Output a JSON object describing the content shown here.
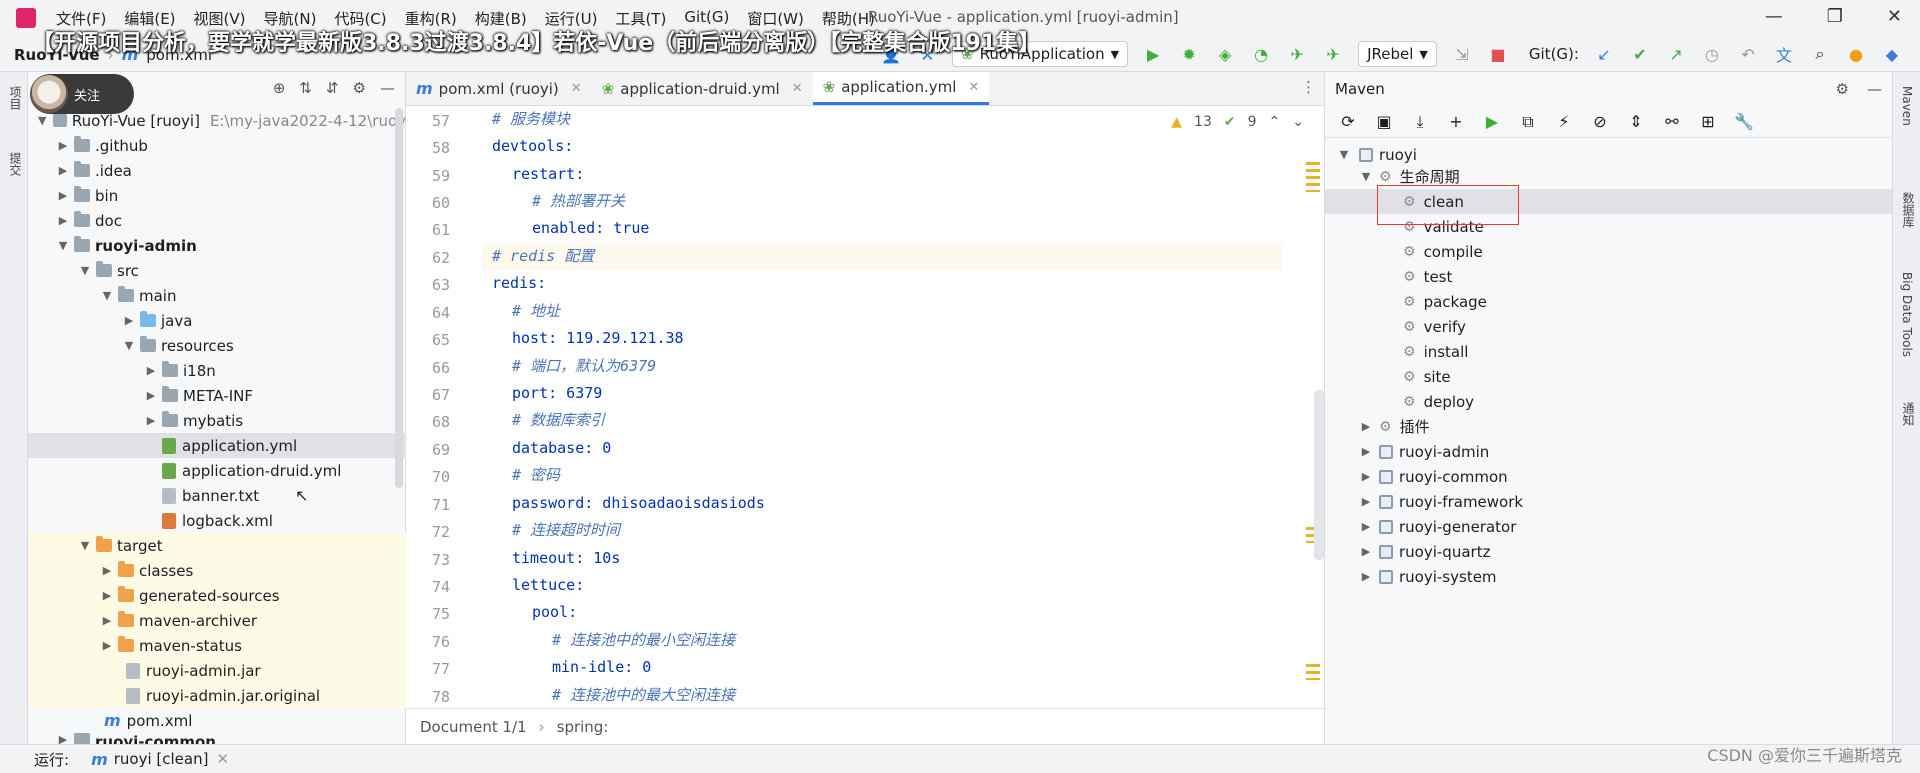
{
  "titlebar": {
    "menu": [
      "文件(F)",
      "编辑(E)",
      "视图(V)",
      "导航(N)",
      "代码(C)",
      "重构(R)",
      "构建(B)",
      "运行(U)",
      "工具(T)",
      "Git(G)",
      "窗口(W)",
      "帮助(H)"
    ],
    "window_title": "RuoYi-Vue - application.yml [ruoyi-admin]",
    "banner": "【开源项目分析，要学就学最新版3.8.3过渡3.8.4】若依-Vue（前后端分离版）【完整集合版191集】"
  },
  "navbar": {
    "crumb_project": "RuoYi-Vue",
    "crumb_file": "pom.xml",
    "run_config": "RuoYiApplication",
    "jrebel": "JRebel",
    "git_label": "Git(G):"
  },
  "left_stripe": {
    "project": "项目",
    "commit": "提交"
  },
  "right_stripe": {
    "maven": "Maven",
    "database": "数据库",
    "bigdata": "Big Data Tools",
    "notify": "通知"
  },
  "project": {
    "follow": "关注",
    "root_name": "RuoYi-Vue [ruoyi]",
    "root_path": "E:\\my-java2022-4-12\\ruoy",
    "items": [
      {
        "label": ".github",
        "kind": "folder"
      },
      {
        "label": ".idea",
        "kind": "folder"
      },
      {
        "label": "bin",
        "kind": "folder"
      },
      {
        "label": "doc",
        "kind": "folder"
      },
      {
        "label": "ruoyi-admin",
        "kind": "module"
      },
      {
        "label": "src",
        "kind": "folder"
      },
      {
        "label": "main",
        "kind": "folder"
      },
      {
        "label": "java",
        "kind": "folder"
      },
      {
        "label": "resources",
        "kind": "folder"
      },
      {
        "label": "i18n",
        "kind": "folder"
      },
      {
        "label": "META-INF",
        "kind": "folder"
      },
      {
        "label": "mybatis",
        "kind": "folder"
      },
      {
        "label": "application.yml",
        "kind": "file"
      },
      {
        "label": "application-druid.yml",
        "kind": "file"
      },
      {
        "label": "banner.txt",
        "kind": "file"
      },
      {
        "label": "logback.xml",
        "kind": "file"
      },
      {
        "label": "target",
        "kind": "folder"
      },
      {
        "label": "classes",
        "kind": "folder"
      },
      {
        "label": "generated-sources",
        "kind": "folder"
      },
      {
        "label": "maven-archiver",
        "kind": "folder"
      },
      {
        "label": "maven-status",
        "kind": "folder"
      },
      {
        "label": "ruoyi-admin.jar",
        "kind": "file"
      },
      {
        "label": "ruoyi-admin.jar.original",
        "kind": "file"
      },
      {
        "label": "pom.xml",
        "kind": "file"
      },
      {
        "label": "ruoyi-common",
        "kind": "module"
      }
    ]
  },
  "editor": {
    "tabs": [
      "pom.xml (ruoyi)",
      "application-druid.yml",
      "application.yml"
    ],
    "warnings": "13",
    "weak_warnings": "9",
    "lines": [
      {
        "no": "57",
        "text": "# 服务模块"
      },
      {
        "no": "58",
        "text": "devtools:"
      },
      {
        "no": "59",
        "text": "restart:"
      },
      {
        "no": "60",
        "text": "# 热部署开关"
      },
      {
        "no": "61",
        "text": "enabled: true"
      },
      {
        "no": "62",
        "text": "# redis 配置"
      },
      {
        "no": "63",
        "text": "redis:"
      },
      {
        "no": "64",
        "text": "# 地址"
      },
      {
        "no": "65",
        "text": "host: 119.29.121.38"
      },
      {
        "no": "66",
        "text": "# 端口，默认为6379"
      },
      {
        "no": "67",
        "text": "port: 6379"
      },
      {
        "no": "68",
        "text": "# 数据库索引"
      },
      {
        "no": "69",
        "text": "database: 0"
      },
      {
        "no": "70",
        "text": "# 密码"
      },
      {
        "no": "71",
        "text": "password: dhisoadaoisdasiods"
      },
      {
        "no": "72",
        "text": "# 连接超时时间"
      },
      {
        "no": "73",
        "text": "timeout: 10s"
      },
      {
        "no": "74",
        "text": "lettuce:"
      },
      {
        "no": "75",
        "text": "pool:"
      },
      {
        "no": "76",
        "text": "# 连接池中的最小空闲连接"
      },
      {
        "no": "77",
        "text": "min-idle: 0"
      },
      {
        "no": "78",
        "text": "# 连接池中的最大空闲连接"
      }
    ],
    "footer_doc": "Document 1/1",
    "footer_path": "spring:"
  },
  "maven": {
    "title": "Maven",
    "root": "ruoyi",
    "lifecycle": "生命周期",
    "phases": [
      "clean",
      "validate",
      "compile",
      "test",
      "package",
      "verify",
      "install",
      "site",
      "deploy"
    ],
    "plugins": "插件",
    "modules": [
      "ruoyi-admin",
      "ruoyi-common",
      "ruoyi-framework",
      "ruoyi-generator",
      "ruoyi-quartz",
      "ruoyi-system"
    ]
  },
  "statusbar": {
    "run_label": "运行:",
    "run_item": "ruoyi [clean]"
  },
  "watermark": "CSDN @爱你三千遍斯塔克"
}
